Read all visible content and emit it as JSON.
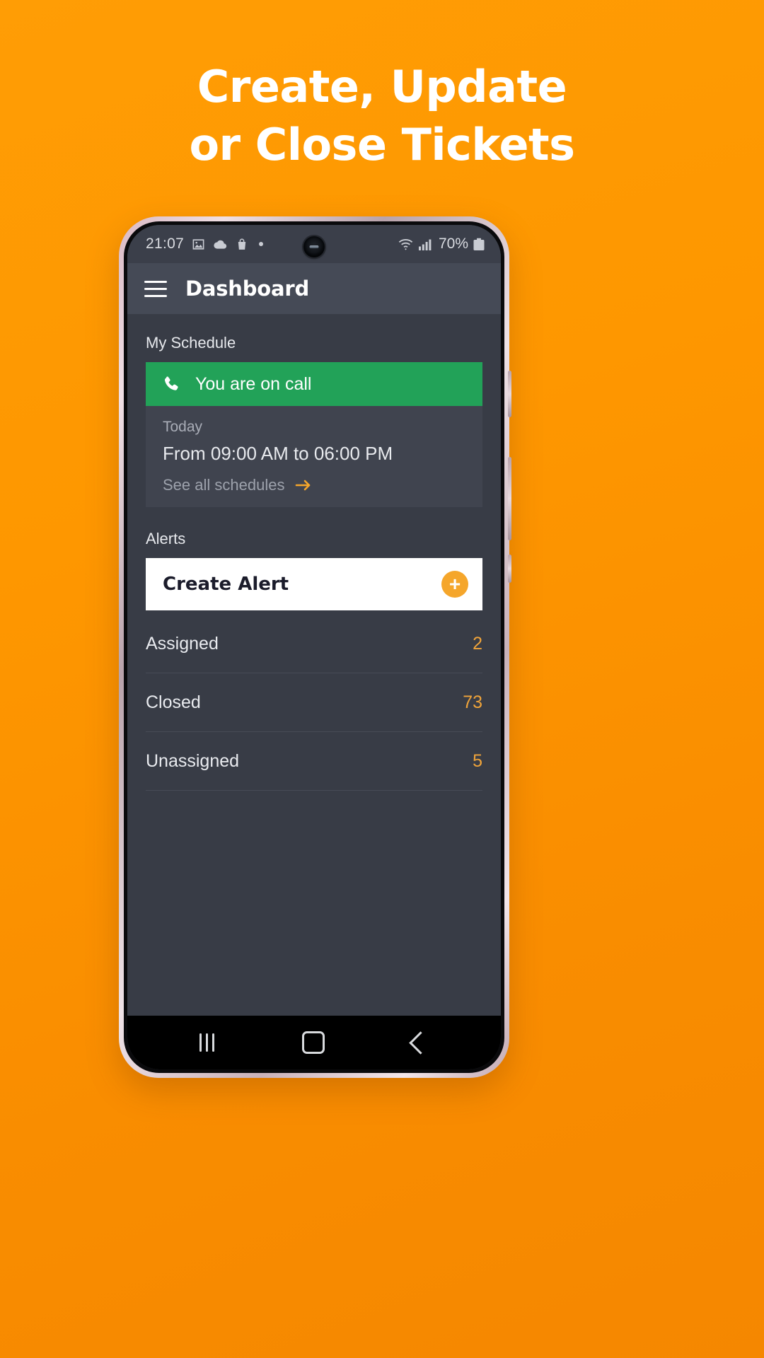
{
  "promo": {
    "headline_line1": "Create, Update",
    "headline_line2": "or Close Tickets",
    "background_color": "#ff9900"
  },
  "status_bar": {
    "time": "21:07",
    "left_icons": [
      "image-icon",
      "cloud-icon",
      "shopping-bag-icon",
      "dot-icon"
    ],
    "wifi_icon": "wifi-icon",
    "signal_icon": "cellular-signal-icon",
    "battery_text": "70%",
    "battery_icon": "battery-icon"
  },
  "app_bar": {
    "menu_icon": "hamburger-menu-icon",
    "title": "Dashboard"
  },
  "schedule": {
    "section_label": "My Schedule",
    "oncall_icon": "phone-icon",
    "oncall_text": "You are on call",
    "oncall_color": "#22a258",
    "day_label": "Today",
    "time_range": "From 09:00 AM to 06:00 PM",
    "see_all_label": "See all schedules",
    "see_all_arrow_icon": "arrow-right-icon",
    "accent_color": "#f5a62b"
  },
  "alerts": {
    "section_label": "Alerts",
    "create_label": "Create Alert",
    "create_plus_icon": "plus-icon",
    "stats": [
      {
        "label": "Assigned",
        "value": "2"
      },
      {
        "label": "Closed",
        "value": "73"
      },
      {
        "label": "Unassigned",
        "value": "5"
      }
    ]
  },
  "nav_bar": {
    "recents_icon": "recents-icon",
    "home_icon": "home-icon",
    "back_icon": "back-icon"
  }
}
